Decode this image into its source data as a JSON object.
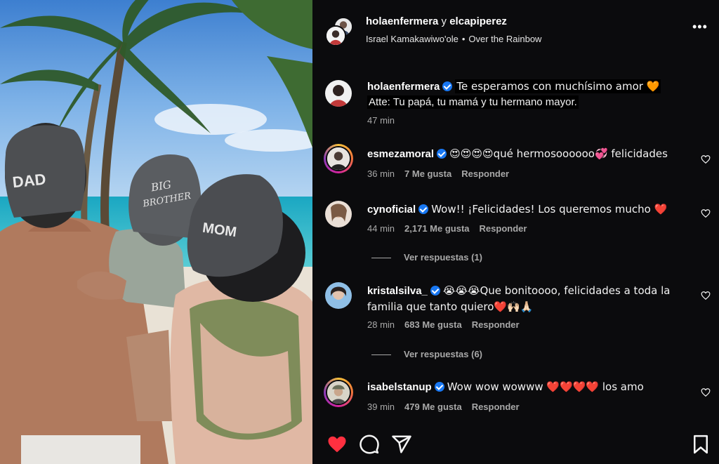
{
  "header": {
    "user1": "holaenfermera",
    "joiner": "y",
    "user2": "elcapiperez",
    "artist": "Israel Kamakawiwo'ole",
    "separator": "•",
    "song": "Over the Rainbow",
    "more_label": "•••"
  },
  "photo": {
    "cap1": "DAD",
    "cap2_line1": "BIG",
    "cap2_line2": "BROTHER",
    "cap3": "MOM"
  },
  "caption": {
    "user": "holaenfermera",
    "line1": "Te esperamos con muchísimo amor 🧡",
    "line2": "Atte: Tu papá, tu mamá y tu hermano mayor.",
    "time": "47 min"
  },
  "comments": [
    {
      "user": "esmezamoral",
      "verified": true,
      "text": "😍😍😍😍qué hermosoooooo💞 felicidades",
      "time": "36 min",
      "likes": "7 Me gusta",
      "reply": "Responder"
    },
    {
      "user": "cynoficial",
      "verified": true,
      "text": "Wow!! ¡Felicidades! Los queremos mucho ❤️",
      "time": "44 min",
      "likes": "2,171 Me gusta",
      "reply": "Responder",
      "view_replies": "Ver respuestas (1)"
    },
    {
      "user": "kristalsilva_",
      "verified": true,
      "text": "😭😭😭Que bonitoooo, felicidades a toda la familia que tanto quiero❤️🙌🏻🙏🏻",
      "time": "28 min",
      "likes": "683 Me gusta",
      "reply": "Responder",
      "view_replies": "Ver respuestas (6)"
    },
    {
      "user": "isabelstanup",
      "verified": true,
      "text": "Wow wow wowww ❤️❤️❤️❤️ los amo",
      "time": "39 min",
      "likes": "479 Me gusta",
      "reply": "Responder"
    }
  ],
  "colors": {
    "background": "#0b0b0d",
    "like_red": "#ff3040",
    "verified_blue": "#1877f2",
    "muted_text": "#a8a8a8"
  },
  "icons": [
    "heart-filled-icon",
    "comment-icon",
    "share-icon",
    "bookmark-icon",
    "heart-outline-icon",
    "more-icon",
    "verified-icon"
  ]
}
